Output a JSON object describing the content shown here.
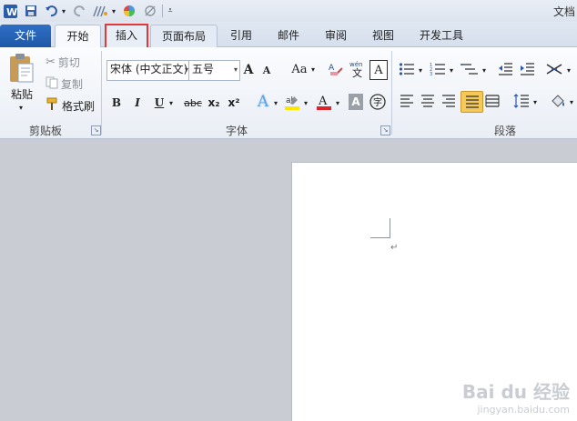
{
  "window": {
    "title": "文档"
  },
  "tabs": [
    {
      "label": "文件"
    },
    {
      "label": "开始"
    },
    {
      "label": "插入"
    },
    {
      "label": "页面布局"
    },
    {
      "label": "引用"
    },
    {
      "label": "邮件"
    },
    {
      "label": "审阅"
    },
    {
      "label": "视图"
    },
    {
      "label": "开发工具"
    }
  ],
  "clipboard": {
    "paste_label": "粘贴",
    "cut_label": "剪切",
    "copy_label": "复制",
    "format_painter_label": "格式刷",
    "group_label": "剪贴板"
  },
  "font": {
    "font_name": "宋体 (中文正文)",
    "font_size": "五号",
    "group_label": "字体",
    "change_case_label": "Aa",
    "bold_label": "B",
    "italic_label": "I",
    "underline_label": "U",
    "strikethrough_label": "abc",
    "subscript_label": "x₂",
    "superscript_label": "x²",
    "grow_label": "A",
    "shrink_label": "A"
  },
  "paragraph": {
    "group_label": "段落"
  },
  "watermark": {
    "line1": "Bai du 经验",
    "line2": "jingyan.baidu.com"
  },
  "colors": {
    "file_tab": "#2b6cc0",
    "highlight_border": "#e0383b",
    "justify_active": "#f5c85a"
  }
}
